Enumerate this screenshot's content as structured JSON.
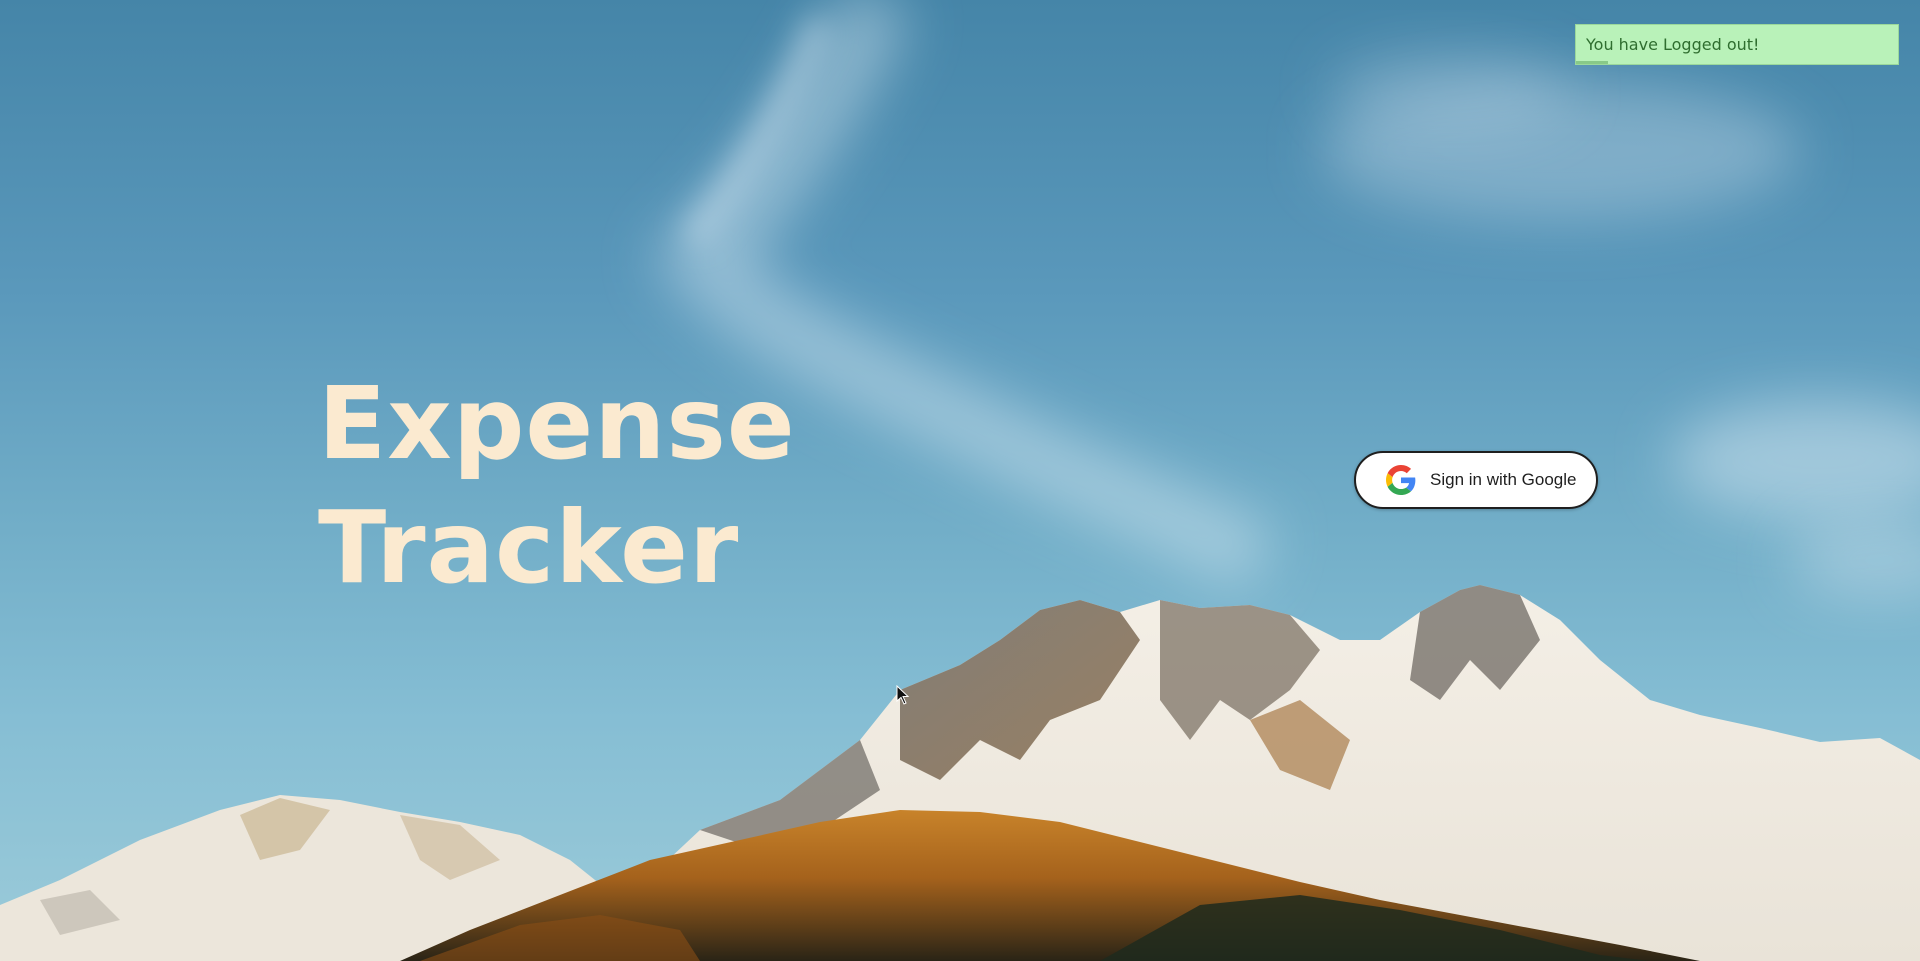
{
  "app": {
    "title_line1": "Expense",
    "title_line2": "Tracker"
  },
  "signin": {
    "label": "Sign in with Google",
    "icon": "google-g-icon"
  },
  "toast": {
    "message": "You have Logged out!",
    "progress": 0.1
  },
  "colors": {
    "title": "#fbead0",
    "toast_bg": "#b9f2b9",
    "toast_text": "#2f6e2f"
  }
}
